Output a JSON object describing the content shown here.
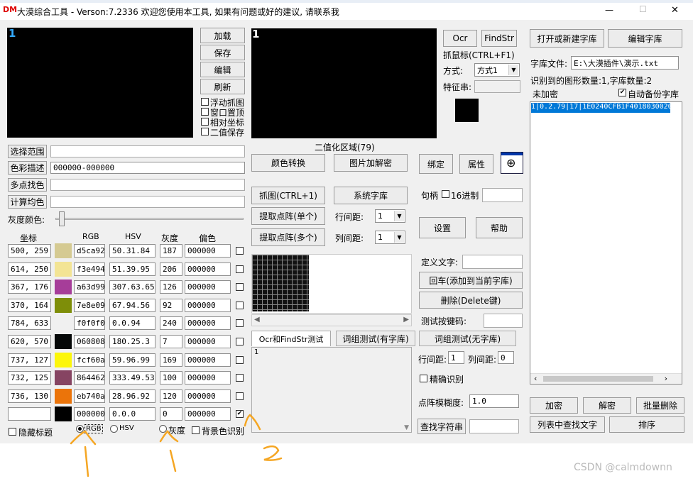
{
  "titlebar": {
    "logo": "DM",
    "title": "大漠综合工具 -  Verson:7.2336  欢迎您使用本工具, 如果有问题或好的建议, 请联系我",
    "min": "—",
    "max": "☐",
    "close": "✕"
  },
  "preview": {
    "left_num": "1",
    "right_num": "1",
    "binarize_label": "二值化区域(79)"
  },
  "topbtns": {
    "load": "加载",
    "save": "保存",
    "edit": "编辑",
    "refresh": "刷新"
  },
  "options": {
    "float": "浮动抓图",
    "ontop": "窗口置顶",
    "relcoord": "相对坐标",
    "binsave": "二值保存"
  },
  "left": {
    "select_range": "选择范围",
    "color_desc": "色彩描述",
    "color_desc_val": "000000-000000",
    "multi_color": "多点找色",
    "avg_color": "计算均色",
    "gray_color": "灰度颜色:"
  },
  "table": {
    "headers": [
      "坐标",
      "RGB",
      "HSV",
      "灰度",
      "偏色"
    ],
    "rows": [
      {
        "coord": "500, 259",
        "swatch": "#d5ca92",
        "rgb": "d5ca92",
        "hsv": "50.31.84",
        "gray": "187",
        "off": "000000",
        "checked": ""
      },
      {
        "coord": "614, 250",
        "swatch": "#f3e494",
        "rgb": "f3e494",
        "hsv": "51.39.95",
        "gray": "206",
        "off": "000000",
        "checked": ""
      },
      {
        "coord": "367, 176",
        "swatch": "#a63d99",
        "rgb": "a63d99",
        "hsv": "307.63.65",
        "gray": "126",
        "off": "000000",
        "checked": ""
      },
      {
        "coord": "370, 164",
        "swatch": "#7e8e09",
        "rgb": "7e8e09",
        "hsv": "67.94.56",
        "gray": "92",
        "off": "000000",
        "checked": ""
      },
      {
        "coord": "784, 633",
        "swatch": "#f0f0f0",
        "rgb": "f0f0f0",
        "hsv": "0.0.94",
        "gray": "240",
        "off": "000000",
        "checked": ""
      },
      {
        "coord": "620, 570",
        "swatch": "#060808",
        "rgb": "060808",
        "hsv": "180.25.3",
        "gray": "7",
        "off": "000000",
        "checked": ""
      },
      {
        "coord": "737, 127",
        "swatch": "#fcf60a",
        "rgb": "fcf60a",
        "hsv": "59.96.99",
        "gray": "169",
        "off": "000000",
        "checked": ""
      },
      {
        "coord": "732, 125",
        "swatch": "#864462",
        "rgb": "864462",
        "hsv": "333.49.53",
        "gray": "100",
        "off": "000000",
        "checked": ""
      },
      {
        "coord": "736, 130",
        "swatch": "#eb740a",
        "rgb": "eb740a",
        "hsv": "28.96.92",
        "gray": "120",
        "off": "000000",
        "checked": ""
      },
      {
        "coord": "",
        "swatch": "#000000",
        "rgb": "000000",
        "hsv": "0.0.0",
        "gray": "0",
        "off": "000000",
        "checked": "✔"
      }
    ]
  },
  "bottom": {
    "hide_title": "隐藏标题",
    "rgb": "RGB",
    "hsv": "HSV",
    "gray": "灰度",
    "bg": "背景色识别"
  },
  "mid": {
    "color_convert": "颜色转换",
    "img_decrypt": "图片加解密",
    "capture": "抓图(CTRL+1)",
    "sys_lib": "系统字库",
    "extract_single": "提取点阵(单个)",
    "extract_multi": "提取点阵(多个)",
    "row_gap": "行间距:",
    "col_gap": "列间距:",
    "row_gap_val": "1",
    "col_gap_val": "1"
  },
  "tabs": {
    "t1": "Ocr和FindStr测试",
    "t2": "词组测试(有字库)",
    "t3": "词组测试(无字库)",
    "textarea": "1"
  },
  "center": {
    "ocr": "Ocr",
    "findstr": "FindStr",
    "grab_mouse": "抓鼠标(CTRL+F1)",
    "mode": "方式:",
    "mode_val": "方式1",
    "feature": "特征串:",
    "bind": "绑定",
    "attr": "属性",
    "handle": "句柄",
    "hex16": "16进制",
    "settings": "设置",
    "help": "帮助",
    "define_text": "定义文字:",
    "enter_add": "回车(添加到当前字库)",
    "delete": "删除(Delete键)",
    "test_key": "测试按键码:",
    "row_gap": "行间距:",
    "row_gap_val": "1",
    "col_gap": "列间距:",
    "col_gap_val": "0",
    "precise": "精确识别",
    "blur": "点阵模糊度:",
    "blur_val": "1.0",
    "find_str": "查找字符串"
  },
  "right": {
    "open_lib": "打开或新建字库",
    "edit_lib": "编辑字库",
    "lib_file_label": "字库文件:",
    "lib_file_val": "E:\\大漠插件\\演示.txt",
    "stats": "识别到的图形数量:1,字库数量:2",
    "unencrypted": "未加密",
    "auto_backup": "自动备份字库",
    "list_item": "1|0.2.79|17|1E0240CFB1F4018030020",
    "encrypt": "加密",
    "decrypt": "解密",
    "batch_delete": "批量删除",
    "find_in_list": "列表中查找文字",
    "sort": "排序"
  },
  "annotations": {
    "a1": "1",
    "a2": "1",
    "a3": "2"
  },
  "watermark": "CSDN @calmdownn"
}
